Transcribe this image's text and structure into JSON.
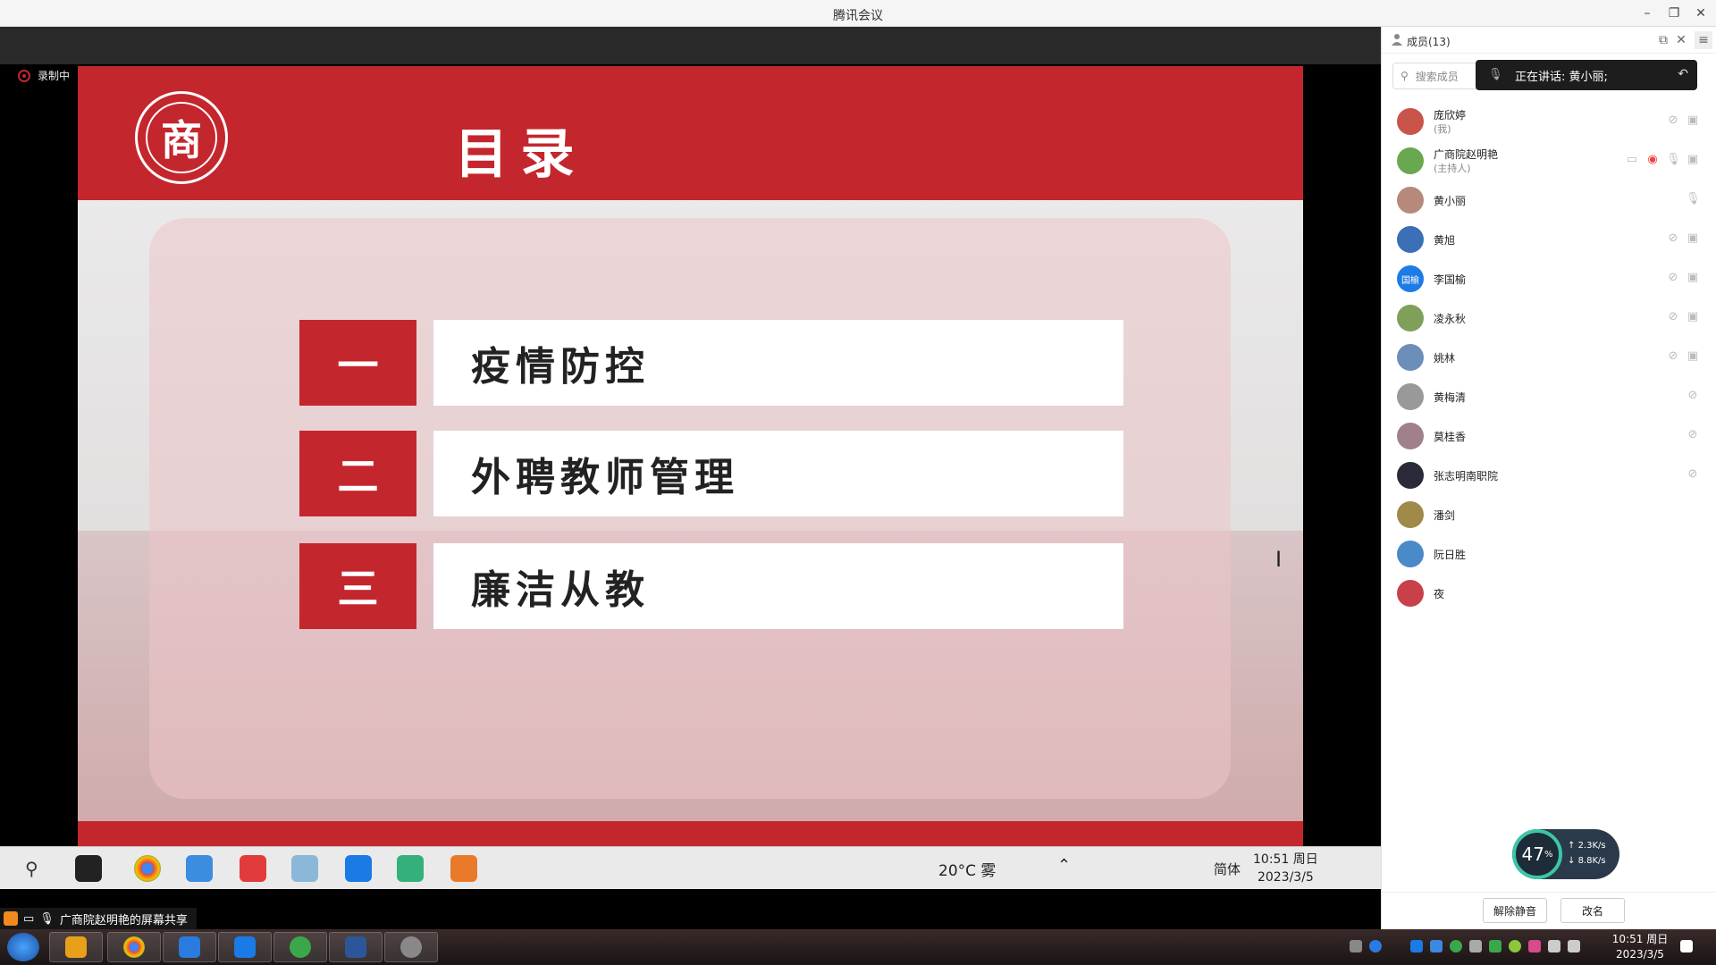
{
  "window": {
    "title": "腾讯会议"
  },
  "recording": {
    "label": "录制中"
  },
  "slide": {
    "title": "目录",
    "logo_char": "商",
    "items": [
      {
        "num": "一",
        "label": "疫情防控"
      },
      {
        "num": "二",
        "label": "外聘教师管理"
      },
      {
        "num": "三",
        "label": "廉洁从教"
      }
    ]
  },
  "shared_taskbar": {
    "weather": "20°C 雾",
    "language": "简体",
    "time": "10:51 周日",
    "date": "2023/3/5"
  },
  "share_banner": {
    "text": "广商院赵明艳的屏幕共享"
  },
  "panel": {
    "title": "成员(13)",
    "search_placeholder": "搜索成员",
    "speaking": "正在讲话: 黄小丽;",
    "members": [
      {
        "name": "庞欣婷",
        "sub": "(我)",
        "color": "#c9544a"
      },
      {
        "name": "广商院赵明艳",
        "sub": "(主持人)",
        "color": "#6aa84f"
      },
      {
        "name": "黄小丽",
        "sub": "",
        "color": "#b58a7a"
      },
      {
        "name": "黄旭",
        "sub": "",
        "color": "#3b6fb6"
      },
      {
        "name": "李国榆",
        "sub": "",
        "color": "#1e7be6",
        "avatar_text": "国榆"
      },
      {
        "name": "凌永秋",
        "sub": "",
        "color": "#7fa05a"
      },
      {
        "name": "姚林",
        "sub": "",
        "color": "#6b8fb8"
      },
      {
        "name": "黄梅清",
        "sub": "",
        "color": "#999999"
      },
      {
        "name": "莫桂香",
        "sub": "",
        "color": "#a0808a"
      },
      {
        "name": "张志明南职院",
        "sub": "",
        "color": "#2a2a3a"
      },
      {
        "name": "潘剑",
        "sub": "",
        "color": "#a08a4a"
      },
      {
        "name": "阮日胜",
        "sub": "",
        "color": "#4a8ac8"
      },
      {
        "name": "夜",
        "sub": "",
        "color": "#c8404a"
      }
    ],
    "unmute_label": "解除静音",
    "rename_label": "改名"
  },
  "net": {
    "percent": "47",
    "percent_unit": "%",
    "up": "2.3K/s",
    "down": "8.8K/s"
  },
  "host_taskbar": {
    "time": "10:51 周日",
    "date": "2023/3/5"
  }
}
